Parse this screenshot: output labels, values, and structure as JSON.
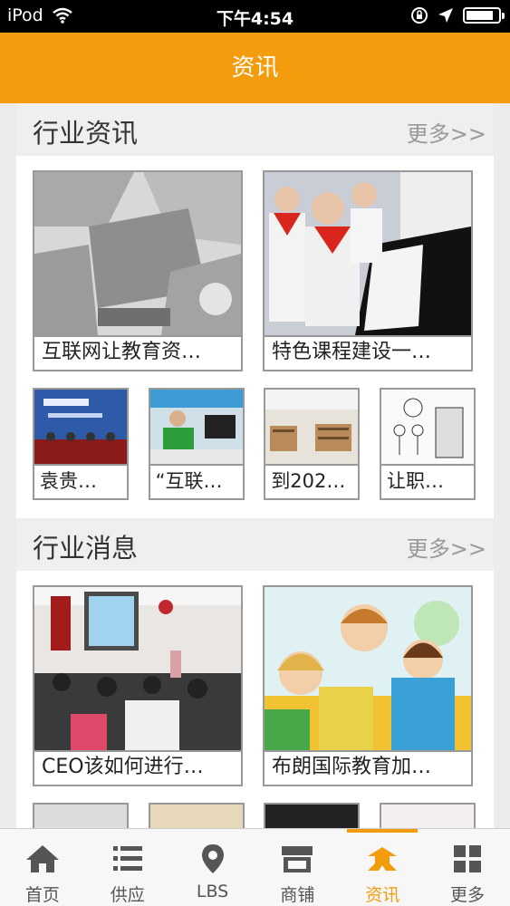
{
  "status_bar": {
    "carrier": "iPod",
    "time": "下午4:54",
    "battery_level": 0.85
  },
  "header": {
    "title": "资讯"
  },
  "sections": [
    {
      "title": "行业资讯",
      "more": "更多>>",
      "featured": [
        {
          "caption": "互联网让教育资…",
          "image": "classroom-collage"
        },
        {
          "caption": "特色课程建设一…",
          "image": "students-piano"
        }
      ],
      "items": [
        {
          "caption": "袁贵…",
          "image": "press-conference"
        },
        {
          "caption": "“互联…",
          "image": "teacher-computer"
        },
        {
          "caption": "到202…",
          "image": "library"
        },
        {
          "caption": "让职…",
          "image": "cartoon"
        }
      ]
    },
    {
      "title": "行业消息",
      "more": "更多>>",
      "featured": [
        {
          "caption": "CEO该如何进行…",
          "image": "lecture-hall"
        },
        {
          "caption": "布朗国际教育加…",
          "image": "kids-reading"
        }
      ]
    }
  ],
  "tab_bar": [
    {
      "label": "首页",
      "icon": "home-icon"
    },
    {
      "label": "供应",
      "icon": "list-icon"
    },
    {
      "label": "LBS",
      "icon": "location-pin-icon"
    },
    {
      "label": "商铺",
      "icon": "store-icon"
    },
    {
      "label": "资讯",
      "icon": "news-icon",
      "active": true
    },
    {
      "label": "更多",
      "icon": "grid-icon"
    }
  ],
  "colors": {
    "accent": "#f39c0e",
    "inactive_tab": "#555555"
  }
}
